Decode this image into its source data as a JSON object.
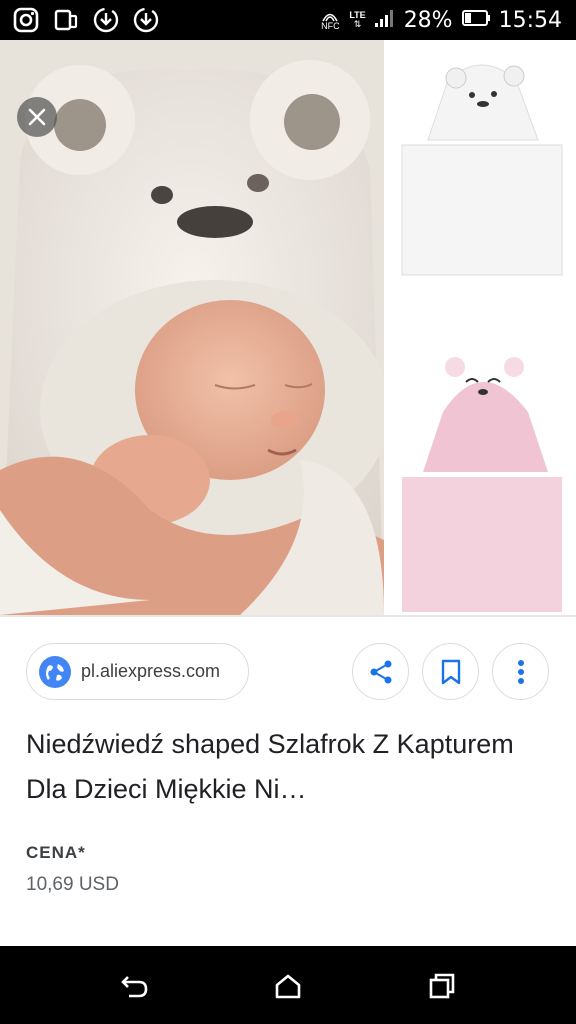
{
  "status_bar": {
    "nfc_label": "NFC",
    "lte_label": "LTE",
    "battery_percent": "28%",
    "time": "15:54",
    "left_icons": [
      "instagram-icon",
      "tablet-icon",
      "download-icon",
      "download-icon"
    ]
  },
  "gallery": {
    "main_image": "baby in white bear hooded towel",
    "thumb1": "white bear hooded towel",
    "thumb2": "pink bear hooded towel"
  },
  "source": {
    "domain": "pl.aliexpress.com",
    "icon": "globe-icon"
  },
  "actions": {
    "share_icon": "share-icon",
    "save_icon": "bookmark-icon",
    "more_icon": "more-vert-icon"
  },
  "product": {
    "title": "Niedźwiedź shaped Szlafrok Z Kapturem Dla Dzieci Miękkie Ni…",
    "price_label": "CENA*",
    "price_value": "10,69 USD"
  },
  "colors": {
    "accent": "#1a73e8",
    "border": "#dadce0",
    "pink_towel": "#f3d1dd"
  }
}
